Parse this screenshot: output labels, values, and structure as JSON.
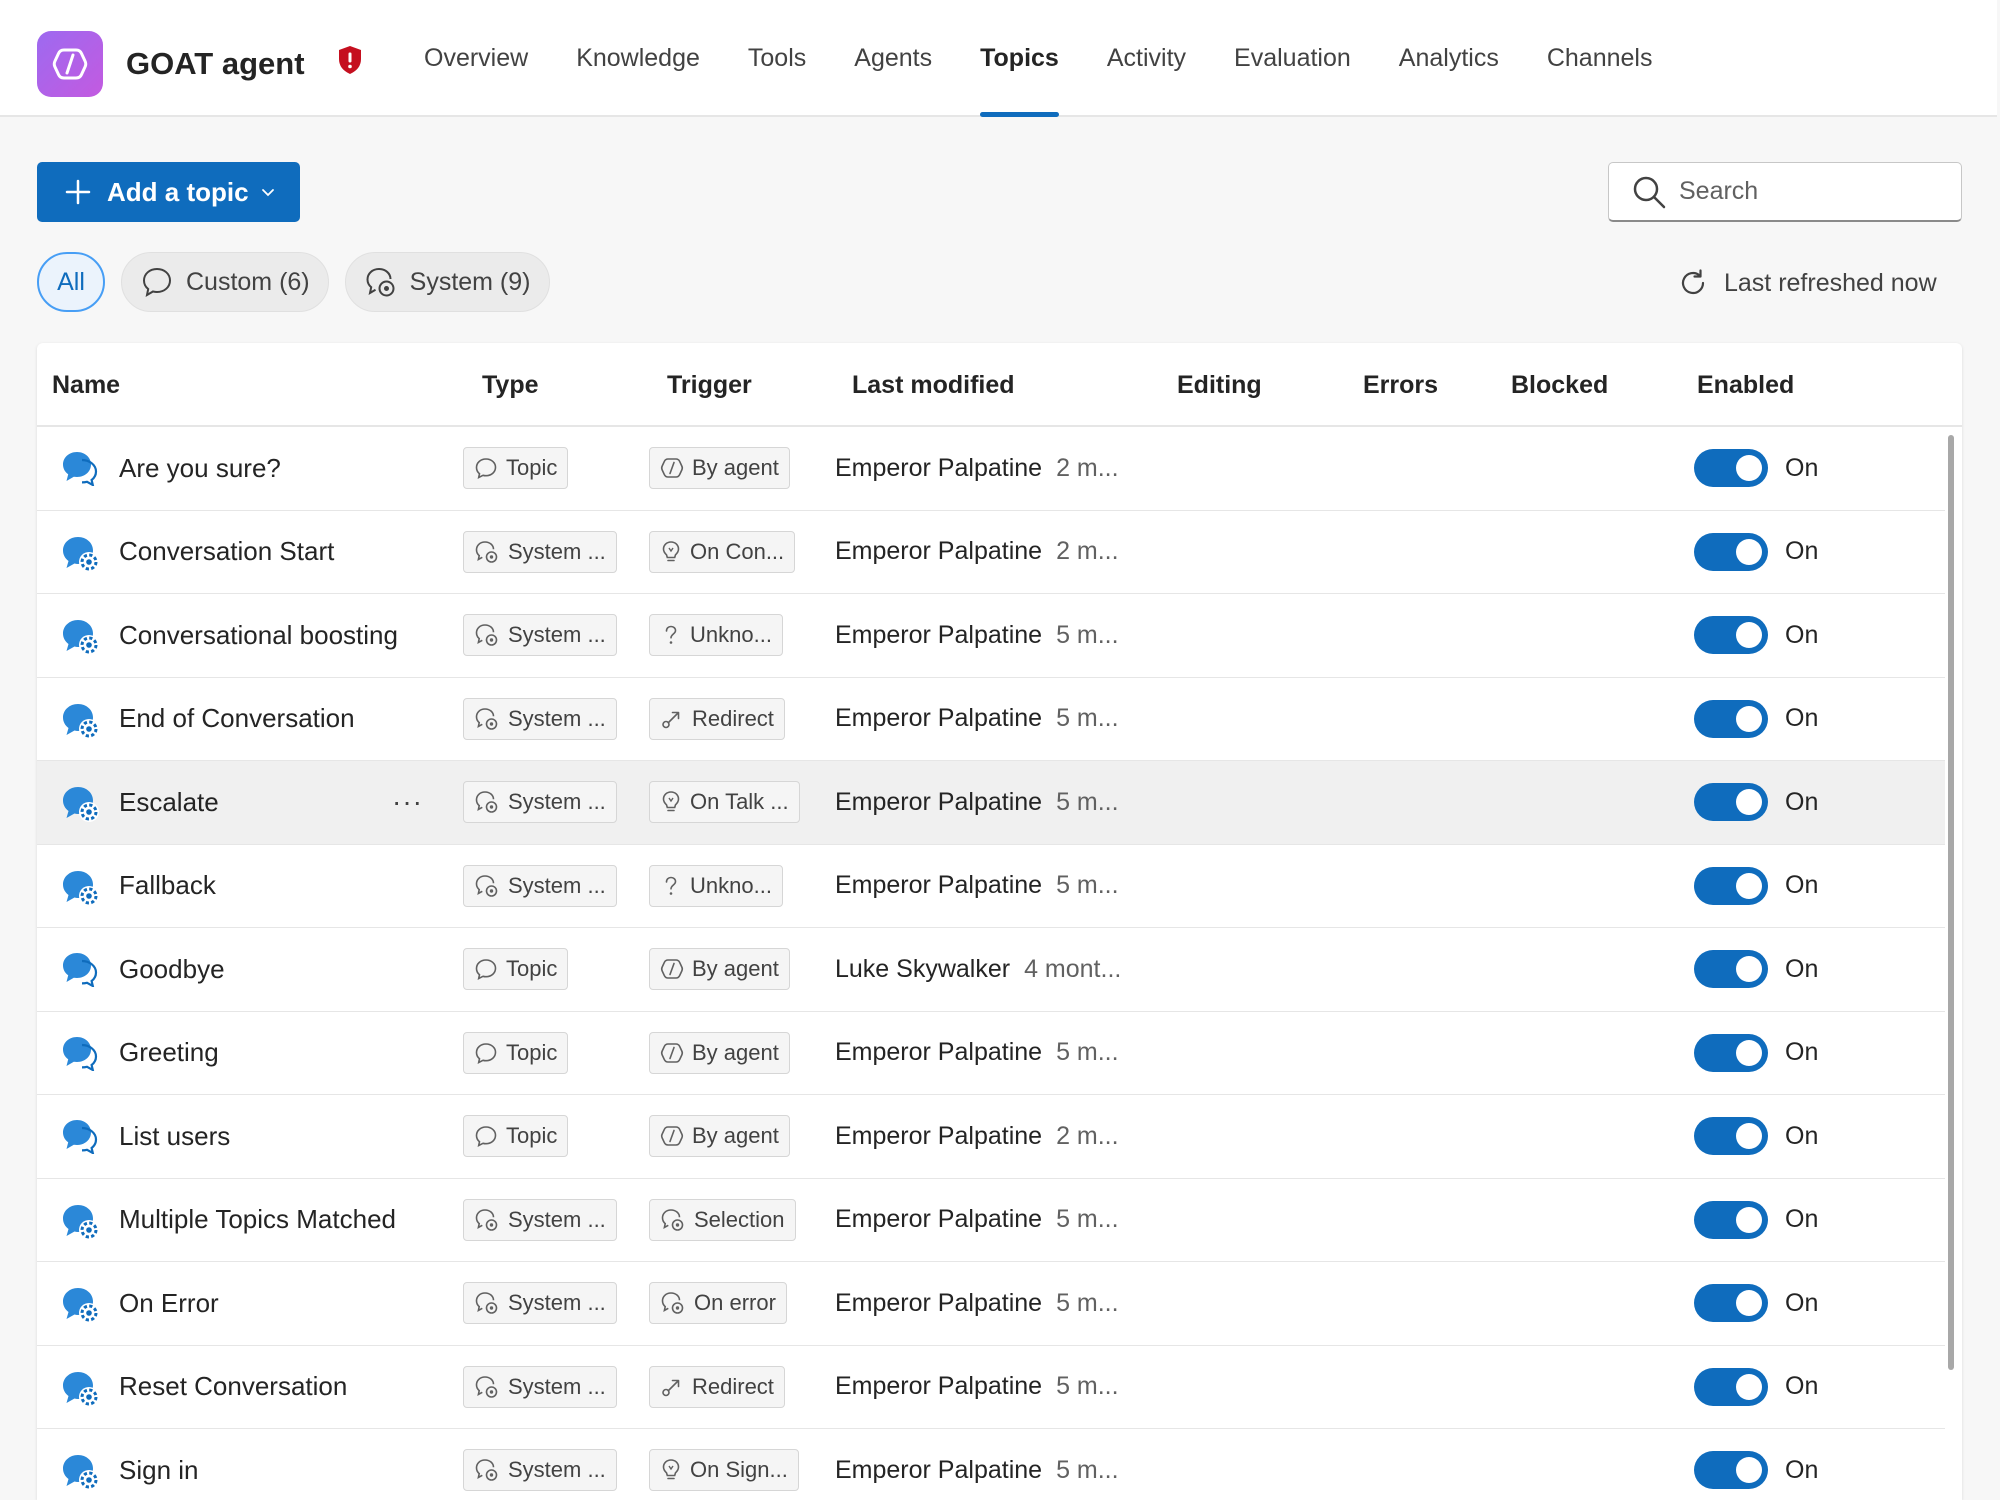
{
  "app": {
    "agent_name": "GOAT agent",
    "logo_icon": "copilot-studio-logo-icon",
    "status_icon": "shield-alert-icon",
    "colors": {
      "accent": "#0f6cbd",
      "logo_gradient_start": "#9d6af0",
      "logo_gradient_end": "#c35ae0",
      "alert": "#c50f1f"
    }
  },
  "nav": {
    "tabs": [
      {
        "label": "Overview",
        "active": false
      },
      {
        "label": "Knowledge",
        "active": false
      },
      {
        "label": "Tools",
        "active": false
      },
      {
        "label": "Agents",
        "active": false
      },
      {
        "label": "Topics",
        "active": true
      },
      {
        "label": "Activity",
        "active": false
      },
      {
        "label": "Evaluation",
        "active": false
      },
      {
        "label": "Analytics",
        "active": false
      },
      {
        "label": "Channels",
        "active": false
      }
    ]
  },
  "toolbar": {
    "add_topic_label": "Add a topic",
    "search_placeholder": "Search",
    "refresh_label": "Last refreshed now"
  },
  "filters": {
    "all_label": "All",
    "custom_label": "Custom (6)",
    "system_label": "System (9)"
  },
  "table": {
    "columns": {
      "name": "Name",
      "type": "Type",
      "trigger": "Trigger",
      "last_modified": "Last modified",
      "editing": "Editing",
      "errors": "Errors",
      "blocked": "Blocked",
      "enabled": "Enabled"
    },
    "rows": [
      {
        "name": "Are you sure?",
        "kind": "custom",
        "type": "Topic",
        "trigger": "By agent",
        "trigger_icon": "agent-trigger-icon",
        "modified_by": "Emperor Palpatine",
        "modified_when": "2 m...",
        "enabled": "On"
      },
      {
        "name": "Conversation Start",
        "kind": "system",
        "type": "System ...",
        "trigger": "On Con...",
        "trigger_icon": "lightbulb-icon",
        "modified_by": "Emperor Palpatine",
        "modified_when": "2 m...",
        "enabled": "On"
      },
      {
        "name": "Conversational boosting",
        "kind": "system",
        "type": "System ...",
        "trigger": "Unkno...",
        "trigger_icon": "question-icon",
        "modified_by": "Emperor Palpatine",
        "modified_when": "5 m...",
        "enabled": "On"
      },
      {
        "name": "End of Conversation",
        "kind": "system",
        "type": "System ...",
        "trigger": "Redirect",
        "trigger_icon": "redirect-icon",
        "modified_by": "Emperor Palpatine",
        "modified_when": "5 m...",
        "enabled": "On"
      },
      {
        "name": "Escalate",
        "kind": "system",
        "type": "System ...",
        "trigger": "On Talk ...",
        "trigger_icon": "lightbulb-icon",
        "modified_by": "Emperor Palpatine",
        "modified_when": "5 m...",
        "enabled": "On",
        "hovered": true,
        "more": "···"
      },
      {
        "name": "Fallback",
        "kind": "system",
        "type": "System ...",
        "trigger": "Unkno...",
        "trigger_icon": "question-icon",
        "modified_by": "Emperor Palpatine",
        "modified_when": "5 m...",
        "enabled": "On"
      },
      {
        "name": "Goodbye",
        "kind": "custom",
        "type": "Topic",
        "trigger": "By agent",
        "trigger_icon": "agent-trigger-icon",
        "modified_by": "Luke Skywalker",
        "modified_when": "4 mont...",
        "enabled": "On"
      },
      {
        "name": "Greeting",
        "kind": "custom",
        "type": "Topic",
        "trigger": "By agent",
        "trigger_icon": "agent-trigger-icon",
        "modified_by": "Emperor Palpatine",
        "modified_when": "5 m...",
        "enabled": "On"
      },
      {
        "name": "List users",
        "kind": "custom",
        "type": "Topic",
        "trigger": "By agent",
        "trigger_icon": "agent-trigger-icon",
        "modified_by": "Emperor Palpatine",
        "modified_when": "2 m...",
        "enabled": "On"
      },
      {
        "name": "Multiple Topics Matched",
        "kind": "system",
        "type": "System ...",
        "trigger": "Selection",
        "trigger_icon": "system-chat-icon",
        "modified_by": "Emperor Palpatine",
        "modified_when": "5 m...",
        "enabled": "On"
      },
      {
        "name": "On Error",
        "kind": "system",
        "type": "System ...",
        "trigger": "On error",
        "trigger_icon": "system-chat-icon",
        "modified_by": "Emperor Palpatine",
        "modified_when": "5 m...",
        "enabled": "On"
      },
      {
        "name": "Reset Conversation",
        "kind": "system",
        "type": "System ...",
        "trigger": "Redirect",
        "trigger_icon": "redirect-icon",
        "modified_by": "Emperor Palpatine",
        "modified_when": "5 m...",
        "enabled": "On"
      },
      {
        "name": "Sign in",
        "kind": "system",
        "type": "System ...",
        "trigger": "On Sign...",
        "trigger_icon": "lightbulb-icon",
        "modified_by": "Emperor Palpatine",
        "modified_when": "5 m...",
        "enabled": "On"
      }
    ]
  }
}
